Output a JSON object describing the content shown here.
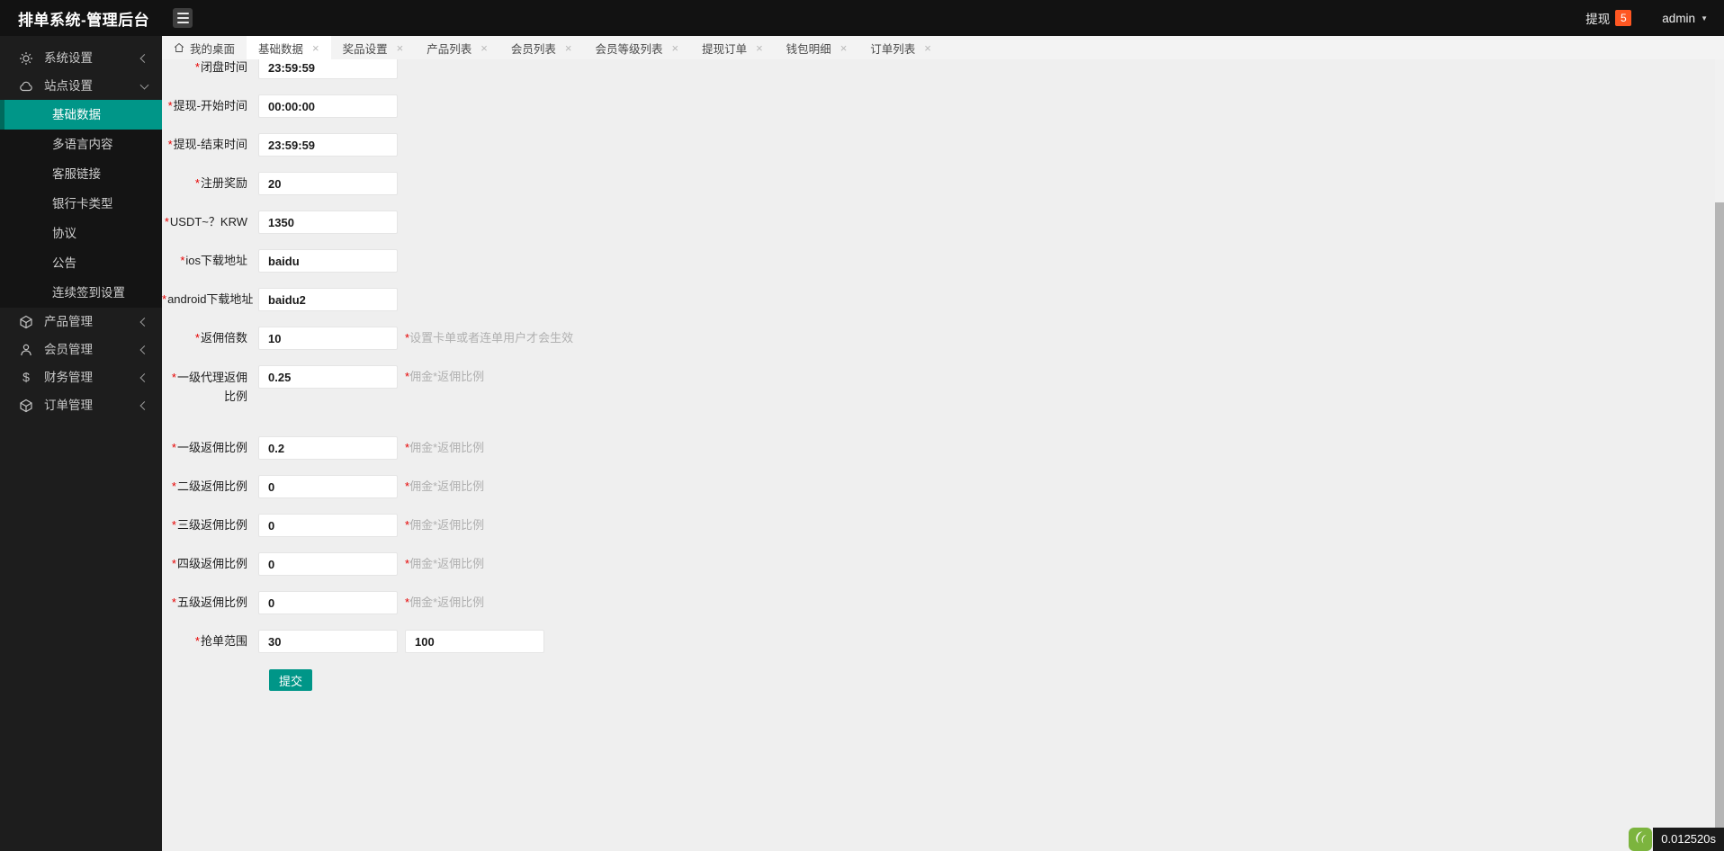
{
  "header": {
    "title": "排单系统-管理后台",
    "withdraw_label": "提现",
    "withdraw_badge": "5",
    "username": "admin"
  },
  "icons": {
    "close": "×",
    "caret_down": "▼",
    "finance_glyph": "$"
  },
  "sidebar": {
    "items": [
      {
        "label": "系统设置",
        "icon": "gear-icon",
        "state": "collapsed"
      },
      {
        "label": "站点设置",
        "icon": "cloud-icon",
        "state": "expanded",
        "children": [
          "基础数据",
          "多语言内容",
          "客服链接",
          "银行卡类型",
          "协议",
          "公告",
          "连续签到设置"
        ],
        "active_child": "基础数据"
      },
      {
        "label": "产品管理",
        "icon": "cube-icon",
        "state": "collapsed"
      },
      {
        "label": "会员管理",
        "icon": "person-icon",
        "state": "collapsed"
      },
      {
        "label": "财务管理",
        "icon": "dollar-icon",
        "state": "collapsed"
      },
      {
        "label": "订单管理",
        "icon": "cube-icon",
        "state": "collapsed"
      }
    ]
  },
  "tabs": [
    {
      "label": "我的桌面",
      "closable": false,
      "active": false
    },
    {
      "label": "基础数据",
      "closable": true,
      "active": true
    },
    {
      "label": "奖品设置",
      "closable": true,
      "active": false
    },
    {
      "label": "产品列表",
      "closable": true,
      "active": false
    },
    {
      "label": "会员列表",
      "closable": true,
      "active": false
    },
    {
      "label": "会员等级列表",
      "closable": true,
      "active": false
    },
    {
      "label": "提现订单",
      "closable": true,
      "active": false
    },
    {
      "label": "钱包明细",
      "closable": true,
      "active": false
    },
    {
      "label": "订单列表",
      "closable": true,
      "active": false
    }
  ],
  "form": {
    "required_mark": "*",
    "fields": [
      {
        "label": "闭盘时间",
        "value": "23:59:59"
      },
      {
        "label": "提现-开始时间",
        "value": "00:00:00"
      },
      {
        "label": "提现-结束时间",
        "value": "23:59:59"
      },
      {
        "label": "注册奖励",
        "value": "20"
      },
      {
        "label": "USDT~？KRW",
        "value": "1350"
      },
      {
        "label": "ios下载地址",
        "value": "baidu"
      },
      {
        "label": "android下载地址",
        "value": "baidu2"
      },
      {
        "label": "返佣倍数",
        "value": "10",
        "hint": "设置卡单或者连单用户才会生效"
      },
      {
        "label": "一级代理返佣比例",
        "value": "0.25",
        "hint": "佣金*返佣比例"
      },
      {
        "label": "一级返佣比例",
        "value": "0.2",
        "hint": "佣金*返佣比例"
      },
      {
        "label": "二级返佣比例",
        "value": "0",
        "hint": "佣金*返佣比例"
      },
      {
        "label": "三级返佣比例",
        "value": "0",
        "hint": "佣金*返佣比例"
      },
      {
        "label": "四级返佣比例",
        "value": "0",
        "hint": "佣金*返佣比例"
      },
      {
        "label": "五级返佣比例",
        "value": "0",
        "hint": "佣金*返佣比例"
      }
    ],
    "range_field": {
      "label": "抢单范围",
      "value1": "30",
      "value2": "100"
    },
    "submit_label": "提交"
  },
  "footer": {
    "exec_time": "0.012520s"
  },
  "colors": {
    "accent": "#009688",
    "accent_dark": "#00695c",
    "badge": "#ff5722",
    "logo_green": "#7cb43e",
    "header_bg": "#121212",
    "sidebar_bg": "#1d1d1d"
  }
}
